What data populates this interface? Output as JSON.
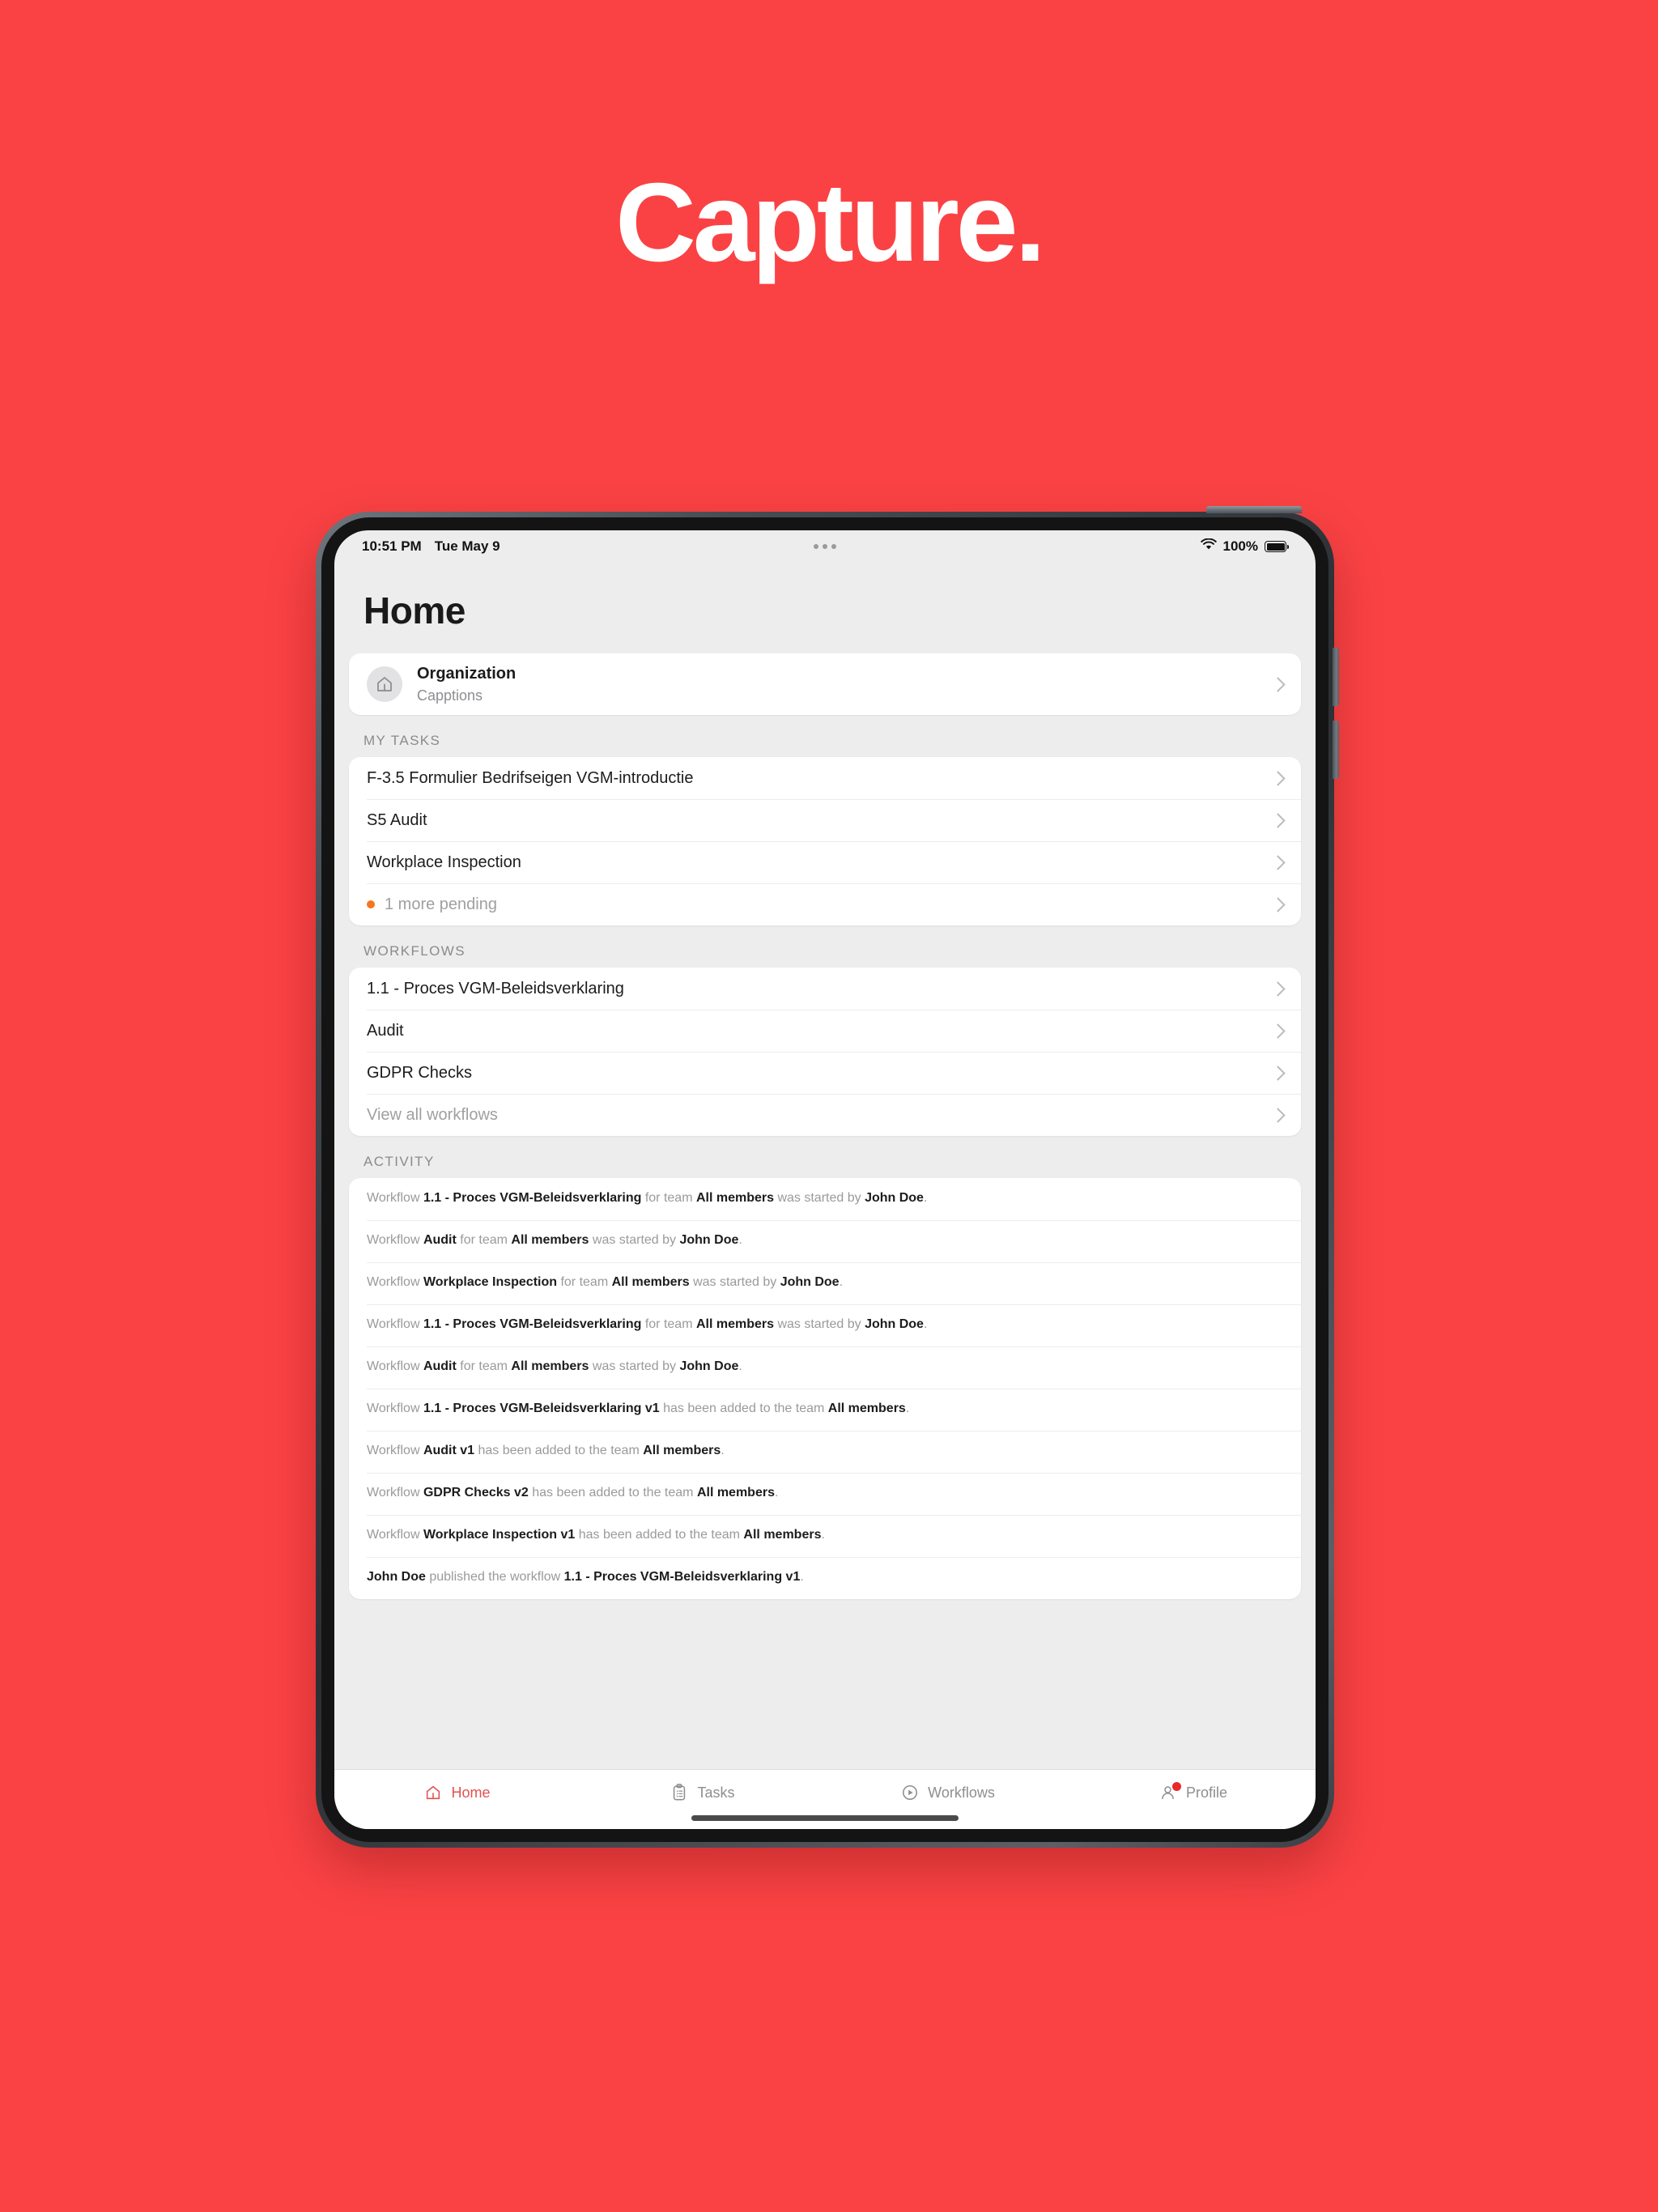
{
  "hero": {
    "title": "Capture.",
    "background_color": "#fa4244",
    "text_color": "#ffffff"
  },
  "device": {
    "status_bar": {
      "time": "10:51 PM",
      "date": "Tue May 9",
      "battery_percent": "100%",
      "wifi_icon": "wifi-icon",
      "battery_icon": "battery-full-icon",
      "center_indicator_icon": "dynamic-island-dots-icon"
    },
    "screen": {
      "page_title": "Home",
      "organization": {
        "icon": "home-building-icon",
        "title": "Organization",
        "subtitle": "Capptions",
        "chevron_icon": "chevron-right-icon"
      },
      "sections": [
        {
          "header": "MY TASKS",
          "rows": [
            {
              "label": "F-3.5 Formulier Bedrifseigen VGM-introductie",
              "muted": false,
              "dot": false
            },
            {
              "label": "S5 Audit",
              "muted": false,
              "dot": false
            },
            {
              "label": "Workplace Inspection",
              "muted": false,
              "dot": false
            },
            {
              "label": "1 more pending",
              "muted": true,
              "dot": true
            }
          ]
        },
        {
          "header": "WORKFLOWS",
          "rows": [
            {
              "label": "1.1 - Proces VGM-Beleidsverklaring",
              "muted": false,
              "dot": false
            },
            {
              "label": "Audit",
              "muted": false,
              "dot": false
            },
            {
              "label": "GDPR Checks",
              "muted": false,
              "dot": false
            },
            {
              "label": "View all workflows",
              "muted": true,
              "dot": false
            }
          ]
        }
      ],
      "activity": {
        "header": "ACTIVITY",
        "items": [
          "Workflow <b>1.1 - Proces VGM-Beleidsverklaring</b> for team <b>All members</b> was started by <b>John Doe</b>.",
          "Workflow <b>Audit</b> for team <b>All members</b> was started by <b>John Doe</b>.",
          "Workflow <b>Workplace Inspection</b> for team <b>All members</b> was started by <b>John Doe</b>.",
          "Workflow <b>1.1 - Proces VGM-Beleidsverklaring</b> for team <b>All members</b> was started by <b>John Doe</b>.",
          "Workflow <b>Audit</b> for team <b>All members</b> was started by <b>John Doe</b>.",
          "Workflow <b>1.1 - Proces VGM-Beleidsverklaring v1</b> has been added to the team <b>All members</b>.",
          "Workflow <b>Audit v1</b> has been added to the team <b>All members</b>.",
          "Workflow <b>GDPR Checks v2</b> has been added to the team <b>All members</b>.",
          "Workflow <b>Workplace Inspection v1</b> has been added to the team <b>All members</b>.",
          "<b>John Doe</b> published the workflow <b>1.1 - Proces VGM-Beleidsverklaring v1</b>."
        ]
      },
      "tab_bar": {
        "active_color": "#e2514f",
        "inactive_color": "#8e8e93",
        "tabs": [
          {
            "label": "Home",
            "icon": "home-icon",
            "active": true,
            "badge": false
          },
          {
            "label": "Tasks",
            "icon": "clipboard-icon",
            "active": false,
            "badge": false
          },
          {
            "label": "Workflows",
            "icon": "play-circle-icon",
            "active": false,
            "badge": false
          },
          {
            "label": "Profile",
            "icon": "person-icon",
            "active": false,
            "badge": true
          }
        ]
      }
    }
  }
}
